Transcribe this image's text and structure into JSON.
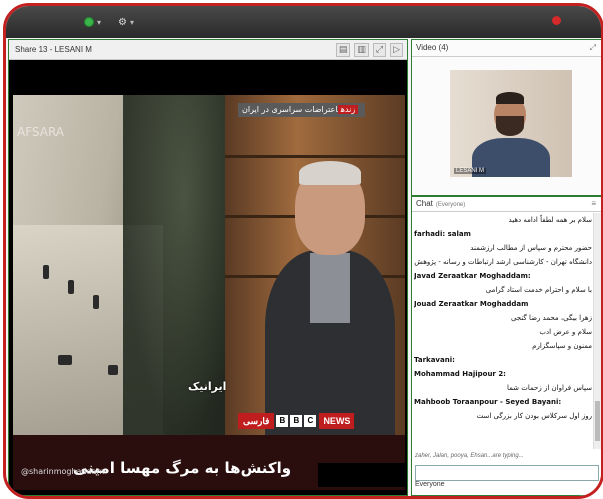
{
  "topbar": {
    "items": [
      {
        "icon": "status-green-icon"
      },
      {
        "icon": "user-settings-icon"
      }
    ]
  },
  "share_pod": {
    "title": "Share 13 - LESANI M",
    "tools": [
      "▤",
      "▥",
      "⤢",
      "▷"
    ],
    "video": {
      "tag_red": "زنده",
      "tag_text": "اعتراضات سراسری در ایران",
      "watermark": "AFSARA",
      "channel_watermark": "ایرانیک",
      "headline": "واکنش‌ها به مرگ مهسا امینی",
      "bbc_lang": "فارسی",
      "bbc_letters": [
        "B",
        "B",
        "C"
      ],
      "bbc_news": "NEWS",
      "handle": "@sharinmoghaddam"
    }
  },
  "video_pod": {
    "title": "Video (4)",
    "menu": "⤢",
    "participant": "LESANI M"
  },
  "chat_pod": {
    "title": "Chat",
    "subtitle": "(Everyone)",
    "menu": "≡",
    "messages": [
      {
        "text": "سلام بر همه لطفاً ادامه دهید",
        "bold": false
      },
      {
        "text": "farhadi: salam",
        "bold": true
      },
      {
        "text": "حضور محترم و سپاس از مطالب ارزشمند",
        "bold": false
      },
      {
        "text": "دانشگاه تهران - کارشناسی ارشد ارتباطات و رسانه - پژوهش در فضای مجازی",
        "bold": false
      },
      {
        "text": "Javad Zeraatkar Moghaddam:",
        "bold": true
      },
      {
        "text": "با سلام و احترام خدمت استاد گرامی",
        "bold": false
      },
      {
        "text": "Jouad Zeraatkar Moghaddam",
        "bold": true
      },
      {
        "text": "زهرا بیگی، محمد رضا گنجی",
        "bold": false
      },
      {
        "text": "سلام و عرض ادب",
        "bold": false
      },
      {
        "text": "ممنون و سپاسگزارم",
        "bold": false
      },
      {
        "text": "Tarkavani:",
        "bold": true
      },
      {
        "text": "Mohammad Hajipour 2:",
        "bold": true
      },
      {
        "text": "سپاس فراوان از زحمات شما",
        "bold": false
      },
      {
        "text": "Mahboob Toraanpour - Seyed Bayani:",
        "bold": true
      },
      {
        "text": "روز اول سرکلاس بودن کار بزرگی است",
        "bold": false
      }
    ],
    "typing": "zaher, Jalan, pooya, Ehsan...are typing...",
    "footer": "Everyone"
  }
}
